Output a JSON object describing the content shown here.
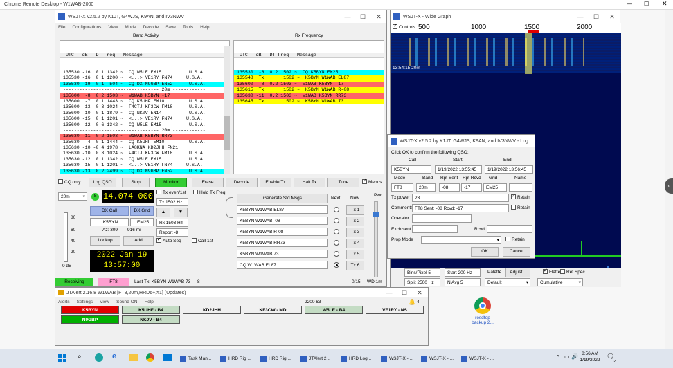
{
  "rdp_title": "Chrome Remote Desktop - W1WAB-2000",
  "wsjtx": {
    "title": "WSJT-X  v2.5.2  by K1JT, G4WJS, K9AN, and IV3NWV",
    "menu": [
      "File",
      "Configurations",
      "View",
      "Mode",
      "Decode",
      "Save",
      "Tools",
      "Help"
    ],
    "band_activity_label": "Band Activity",
    "rx_frequency_label": "Rx Frequency",
    "band_header": " UTC   dB   DT Freq   Message",
    "rx_header": " UTC   dB   DT Freq   Message",
    "band_rows": [
      {
        "t": "135530 -16  0.1 1342 ~  CQ W5LE EM15          U.S.A.",
        "bg": "#ffffff"
      },
      {
        "t": "135530 -16  0.1 1200 ~  <...> VE1RY FN74     U.S.A.",
        "bg": "#ffffff"
      },
      {
        "t": "135530 -19  0.1  504 ~  CQ DX N9GBP EN52      U.S.A.",
        "bg": "#00ffff"
      },
      {
        "t": "----------------------------------- 20m ------------",
        "bg": "#ffffff"
      },
      {
        "t": "135600  -8  0.2 1503 ~  W1WAB K5BYN -17",
        "bg": "#ff6666"
      },
      {
        "t": "135600  -7  0.1 1443 ~  CQ K5UHF EM10         U.S.A.",
        "bg": "#ffffff"
      },
      {
        "t": "135600 -13  0.3 1024 ~  F4CTJ KF3CW FM18      U.S.A.",
        "bg": "#ffffff"
      },
      {
        "t": "135600 -10  0.1 1879 ~  CQ NK0V EN14          U.S.A.",
        "bg": "#ffffff"
      },
      {
        "t": "135600 -15  0.1 1201 ~  <...> VE1RY FN74     U.S.A.",
        "bg": "#ffffff"
      },
      {
        "t": "135600 -12  0.6 1342 ~  CQ W5LE EM15          U.S.A.",
        "bg": "#ffffff"
      },
      {
        "t": "----------------------------------- 20m ------------",
        "bg": "#ffffff"
      },
      {
        "t": "135630 -11  0.2 1503 ~  W1WAB K5BYN RR73",
        "bg": "#ff6666"
      },
      {
        "t": "135630  -4  0.1 1444 ~  CQ K5UHF EM10         U.S.A.",
        "bg": "#ffffff"
      },
      {
        "t": "135630 -10 -0.4 1978 ~  LA8KNA KD2JHH FN21",
        "bg": "#ffffff"
      },
      {
        "t": "135630 -10  0.3 1024 ~  F4CTJ KF3CW FM18      U.S.A.",
        "bg": "#ffffff"
      },
      {
        "t": "135630 -12  0.1 1342 ~  CQ W5LE EM15          U.S.A.",
        "bg": "#ffffff"
      },
      {
        "t": "135630 -15  0.1 1201 ~  <...> VE1RY FN74     U.S.A.",
        "bg": "#ffffff"
      },
      {
        "t": "135630 -13  0.2 2499 ~  CQ DX N9GBP EN52      U.S.A.",
        "bg": "#00ffff"
      },
      {
        "t": "135630 -16  0.1 1880 ~  CQ NK0V EN14          U.S.A.",
        "bg": "#ffffff"
      }
    ],
    "rx_rows": [
      {
        "t": "135530  -8  0.2 1502 ~  CQ K5BYN EM25",
        "bg": "#00ffff"
      },
      {
        "t": "135548  Tx       1502 ~  K5BYN W1WAB EL87",
        "bg": "#ffff00"
      },
      {
        "t": "135600  -8  0.2 1503 ~  W1WAB K5BYN -17",
        "bg": "#ff6666"
      },
      {
        "t": "135615  Tx       1502 ~  K5BYN W1WAB R-08",
        "bg": "#ffff00"
      },
      {
        "t": "135630 -11  0.2 1503 ~  W1WAB K5BYN RR73",
        "bg": "#ff6666"
      },
      {
        "t": "135645  Tx       1502 ~  K5BYN W1WAB 73",
        "bg": "#ffff00"
      }
    ],
    "controls": {
      "cq_only": "CQ only",
      "log_qso": "Log QSO",
      "stop": "Stop",
      "monitor": "Monitor",
      "erase": "Erase",
      "decode": "Decode",
      "enable_tx": "Enable Tx",
      "halt_tx": "Halt Tx",
      "tune": "Tune",
      "menus": "Menus"
    },
    "band": "20m",
    "frequency": "14.074 000",
    "tx_even": "Tx even/1st",
    "hold_tx_freq": "Hold Tx Freq",
    "tx_hz": "Tx  1502  Hz",
    "rx_hz": "Rx  1503  Hz",
    "report": "Report  -8",
    "auto_seq": "Auto Seq",
    "call_1st": "Call 1st",
    "dx_call_label": "DX Call",
    "dx_grid_label": "DX Grid",
    "dx_call": "K5BYN",
    "dx_grid": "EM25",
    "az": "Az: 309",
    "dist": "916 mi",
    "lookup": "Lookup",
    "add": "Add",
    "date": "2022 Jan 19",
    "time": "13:57:00",
    "meter_ticks": [
      "80",
      "60",
      "40",
      "20"
    ],
    "meter_db": "0 dB",
    "generate_std": "Generate Std Msgs",
    "next": "Next",
    "now": "Now",
    "pwr": "Pwr",
    "tx_msgs": [
      {
        "msg": "K5BYN W1WAB EL87",
        "btn": "Tx 1"
      },
      {
        "msg": "K5BYN W1WAB -08",
        "btn": "Tx 2"
      },
      {
        "msg": "K5BYN W1WAB R-08",
        "btn": "Tx 3"
      },
      {
        "msg": "K5BYN W1WAB RR73",
        "btn": "Tx 4"
      },
      {
        "msg": "K5BYN W1WAB 73",
        "btn": "Tx 5"
      },
      {
        "msg": "CQ W1WAB EL87",
        "btn": "Tx 6"
      }
    ],
    "status_receiving": "Receiving",
    "status_mode": "FT8",
    "last_tx": "Last Tx: K5BYN W1WAB 73",
    "status_num": "8",
    "status_count": "0/15",
    "status_wd": "WD:1m"
  },
  "wide_graph": {
    "title": "WSJT-X - Wide Graph",
    "controls": "Controls",
    "scale": [
      "500",
      "1000",
      "1500",
      "2000"
    ],
    "timestamp": "13:54:15   20m",
    "bins_label": "Bins/Pixel  5",
    "start_label": "Start 200 Hz",
    "palette": "Palette",
    "adjust": "Adjust...",
    "flatten": "Flatten",
    "ref_spec": "Ref Spec",
    "split": "Split  2500  Hz",
    "navg": "N Avg  5",
    "default": "Default",
    "cumulative": "Cumulative"
  },
  "log_dialog": {
    "title": "WSJT-X  v2.5.2  by K1JT, G4WJS, K9AN, and IV3NWV - Log...",
    "prompt": "Click OK to confirm the following QSO:",
    "call_label": "Call",
    "start_label": "Start",
    "end_label": "End",
    "call": "K5BYN",
    "start": "1/19/2022 13:55:45",
    "end": "1/19/2022 13:56:45",
    "mode_label": "Mode",
    "band_label": "Band",
    "rpt_sent_label": "Rpt Sent",
    "rpt_rcvd_label": "Rpt Rcvd",
    "grid_label": "Grid",
    "name_label": "Name",
    "mode": "FT8",
    "band": "20m",
    "rpt_sent": "-08",
    "rpt_rcvd": "-17",
    "grid": "EM25",
    "tx_power_label": "Tx power",
    "tx_power": "23",
    "retain": "Retain",
    "comments_label": "Comments",
    "comments": "FT8  Sent: -08  Rcvd: -17",
    "operator_label": "Operator",
    "exch_sent_label": "Exch sent",
    "rcvd_label": "Rcvd",
    "prop_mode_label": "Prop Mode",
    "ok": "OK",
    "cancel": "Cancel"
  },
  "jtalert": {
    "title": "JTAlert 2.16.8 W1WAB [FT8,20m,HRD6+,#1] (Updates)",
    "menu": [
      "Alerts",
      "Settings",
      "View",
      "Sound ON",
      "Help"
    ],
    "counter": "2200  63",
    "bell_count": "4",
    "callsigns": [
      {
        "t": "K5BYN",
        "bg": "#e00000",
        "fg": "#ffffff"
      },
      {
        "t": "K5UHF - B4",
        "bg": "#c4dcc4",
        "fg": "#000000"
      },
      {
        "t": "KD2JHH",
        "bg": "#f0f0f0",
        "fg": "#000000"
      },
      {
        "t": "KF3CW - MD",
        "bg": "#f0f0f0",
        "fg": "#000000"
      },
      {
        "t": "W5LE - B4",
        "bg": "#c4dcc4",
        "fg": "#000000"
      },
      {
        "t": "VE1RY - NS",
        "bg": "#f0f0f0",
        "fg": "#000000"
      },
      {
        "t": "N9GBP",
        "bg": "#00b000",
        "fg": "#ffffff"
      },
      {
        "t": "NK0V - B4",
        "bg": "#c4dcc4",
        "fg": "#000000"
      }
    ]
  },
  "desktop_icon": "resdtop backup 2...",
  "taskbar": {
    "items": [
      "Task Man...",
      "HRD Rig ...",
      "HRD Rig ...",
      "JTAlert 2...",
      "HRD Log...",
      "WSJT-X - ...",
      "WSJT-X - ...",
      "WSJT-X - ..."
    ],
    "time": "8:56 AM",
    "date": "1/19/2022",
    "notif": "2"
  },
  "colors": {
    "monitor_green": "#33cc33",
    "freq_yellow": "#ffff00",
    "waterfall_blue": "#000a50"
  }
}
